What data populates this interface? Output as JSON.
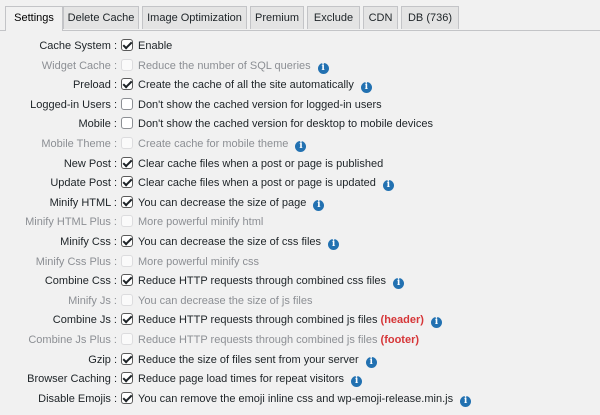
{
  "tabs": [
    {
      "label": "Settings"
    },
    {
      "label": "Delete Cache"
    },
    {
      "label": "Image Optimization"
    },
    {
      "label": "Premium"
    },
    {
      "label": "Exclude"
    },
    {
      "label": "CDN"
    },
    {
      "label": "DB (736)"
    }
  ],
  "info_glyph": "i",
  "rows": [
    {
      "label": "Cache System :",
      "desc": "Enable"
    },
    {
      "label": "Widget Cache :",
      "desc": "Reduce the number of SQL queries"
    },
    {
      "label": "Preload :",
      "desc": "Create the cache of all the site automatically"
    },
    {
      "label": "Logged-in Users :",
      "desc": "Don't show the cached version for logged-in users"
    },
    {
      "label": "Mobile :",
      "desc": "Don't show the cached version for desktop to mobile devices"
    },
    {
      "label": "Mobile Theme :",
      "desc": "Create cache for mobile theme"
    },
    {
      "label": "New Post :",
      "desc": "Clear cache files when a post or page is published"
    },
    {
      "label": "Update Post :",
      "desc": "Clear cache files when a post or page is updated"
    },
    {
      "label": "Minify HTML :",
      "desc": "You can decrease the size of page"
    },
    {
      "label": "Minify HTML Plus :",
      "desc": "More powerful minify html"
    },
    {
      "label": "Minify Css :",
      "desc": "You can decrease the size of css files"
    },
    {
      "label": "Minify Css Plus :",
      "desc": "More powerful minify css"
    },
    {
      "label": "Combine Css :",
      "desc": "Reduce HTTP requests through combined css files"
    },
    {
      "label": "Minify Js :",
      "desc": "You can decrease the size of js files"
    },
    {
      "label": "Combine Js :",
      "desc": "Reduce HTTP requests through combined js files",
      "tag": "(header)"
    },
    {
      "label": "Combine Js Plus :",
      "desc": "Reduce HTTP requests through combined js files",
      "tag": "(footer)"
    },
    {
      "label": "Gzip :",
      "desc": "Reduce the size of files sent from your server"
    },
    {
      "label": "Browser Caching :",
      "desc": "Reduce page load times for repeat visitors"
    },
    {
      "label": "Disable Emojis :",
      "desc": "You can remove the emoji inline css and wp-emoji-release.min.js"
    }
  ]
}
